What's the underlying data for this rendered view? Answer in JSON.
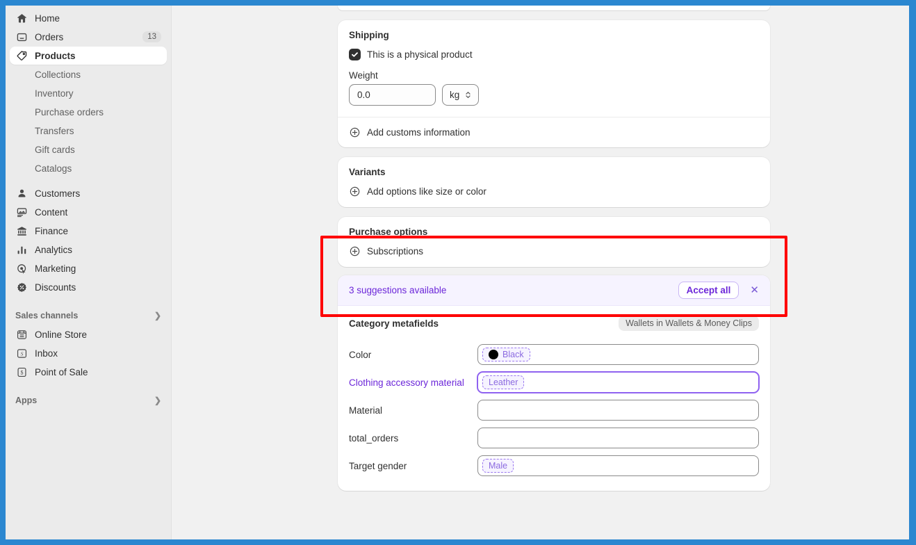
{
  "theme": {
    "frame_color": "#2b87d0",
    "accent_purple": "#6c27d9",
    "annotation_red": "#fe0000",
    "sidebar_bg": "#ebebeb",
    "page_bg": "#f1f1f1"
  },
  "sidebar": {
    "primary": [
      {
        "label": "Home",
        "icon": "home-icon",
        "badge": null,
        "active": false
      },
      {
        "label": "Orders",
        "icon": "orders-inbox-icon",
        "badge": "13",
        "active": false
      },
      {
        "label": "Products",
        "icon": "product-tag-icon",
        "badge": null,
        "active": true
      }
    ],
    "product_sub_items": [
      {
        "label": "Collections"
      },
      {
        "label": "Inventory"
      },
      {
        "label": "Purchase orders"
      },
      {
        "label": "Transfers"
      },
      {
        "label": "Gift cards"
      },
      {
        "label": "Catalogs"
      }
    ],
    "secondary": [
      {
        "label": "Customers",
        "icon": "person-icon"
      },
      {
        "label": "Content",
        "icon": "content-image-icon"
      },
      {
        "label": "Finance",
        "icon": "bank-icon"
      },
      {
        "label": "Analytics",
        "icon": "bar-chart-icon"
      },
      {
        "label": "Marketing",
        "icon": "megaphone-target-icon"
      },
      {
        "label": "Discounts",
        "icon": "discount-percent-icon"
      }
    ],
    "sales_channels": {
      "label": "Sales channels",
      "chevron": "chevron-right-icon",
      "items": [
        {
          "label": "Online Store",
          "icon": "storefront-icon"
        },
        {
          "label": "Inbox",
          "icon": "inbox-chat-icon"
        },
        {
          "label": "Point of Sale",
          "icon": "point-of-sale-icon"
        }
      ]
    },
    "apps": {
      "label": "Apps",
      "chevron": "chevron-right-icon"
    }
  },
  "shipping": {
    "title": "Shipping",
    "physical_product_label": "This is a physical product",
    "physical_product_checked": true,
    "weight_label": "Weight",
    "weight_value": "0.0",
    "weight_unit": "kg",
    "customs_link": "Add customs information",
    "customs_icon": "circle-plus-icon"
  },
  "variants": {
    "title": "Variants",
    "add_options_label": "Add options like size or color",
    "add_options_icon": "circle-plus-icon"
  },
  "purchase_options": {
    "title": "Purchase options",
    "subscriptions_label": "Subscriptions",
    "subscriptions_icon": "circle-plus-icon",
    "highlighted": true
  },
  "suggestions": {
    "count_text": "3 suggestions available",
    "accept_all_label": "Accept all",
    "close_icon": "close-icon"
  },
  "category_metafields": {
    "title": "Category metafields",
    "category_badge": "Wallets in Wallets & Money Clips",
    "rows": [
      {
        "label": "Color",
        "value": "Black",
        "suggested": true,
        "label_suggested": false,
        "focused": false,
        "swatch": "#000000"
      },
      {
        "label": "Clothing accessory material",
        "value": "Leather",
        "suggested": true,
        "label_suggested": true,
        "focused": true,
        "swatch": null
      },
      {
        "label": "Material",
        "value": "",
        "suggested": false,
        "label_suggested": false,
        "focused": false,
        "swatch": null
      },
      {
        "label": "total_orders",
        "value": "",
        "suggested": false,
        "label_suggested": false,
        "focused": false,
        "swatch": null
      },
      {
        "label": "Target gender",
        "value": "Male",
        "suggested": true,
        "label_suggested": false,
        "focused": false,
        "swatch": null
      }
    ]
  }
}
